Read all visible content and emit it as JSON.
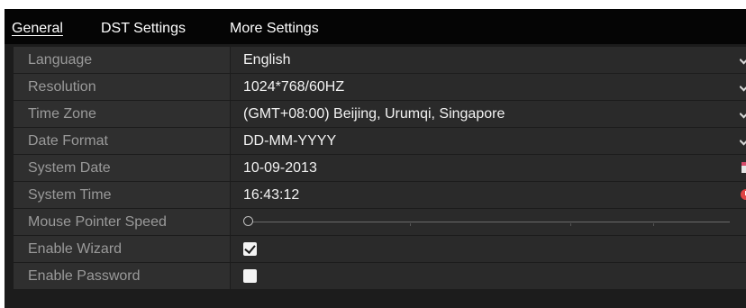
{
  "tabs": [
    {
      "label": "General",
      "active": true
    },
    {
      "label": "DST Settings",
      "active": false
    },
    {
      "label": "More Settings",
      "active": false
    }
  ],
  "settings": {
    "language": {
      "label": "Language",
      "value": "English"
    },
    "resolution": {
      "label": "Resolution",
      "value": "1024*768/60HZ"
    },
    "time_zone": {
      "label": "Time Zone",
      "value": "(GMT+08:00) Beijing, Urumqi, Singapore"
    },
    "date_format": {
      "label": "Date Format",
      "value": "DD-MM-YYYY"
    },
    "system_date": {
      "label": "System Date",
      "value": "10-09-2013"
    },
    "system_time": {
      "label": "System Time",
      "value": "16:43:12"
    },
    "mouse_pointer_speed": {
      "label": "Mouse Pointer Speed",
      "value_fraction": 0.0
    },
    "enable_wizard": {
      "label": "Enable Wizard",
      "checked": true
    },
    "enable_password": {
      "label": "Enable Password",
      "checked": false
    }
  },
  "icons": {
    "dropdown": "chevron-down-icon",
    "calendar": "calendar-icon",
    "clock": "clock-icon"
  },
  "colors": {
    "background": "#1c1c1c",
    "tabbar": "#050505",
    "label_cell": "#2f2f2f",
    "value_cell": "#2a2a2a",
    "label_text": "#9a9a9a",
    "value_text": "#f2f2f2"
  }
}
